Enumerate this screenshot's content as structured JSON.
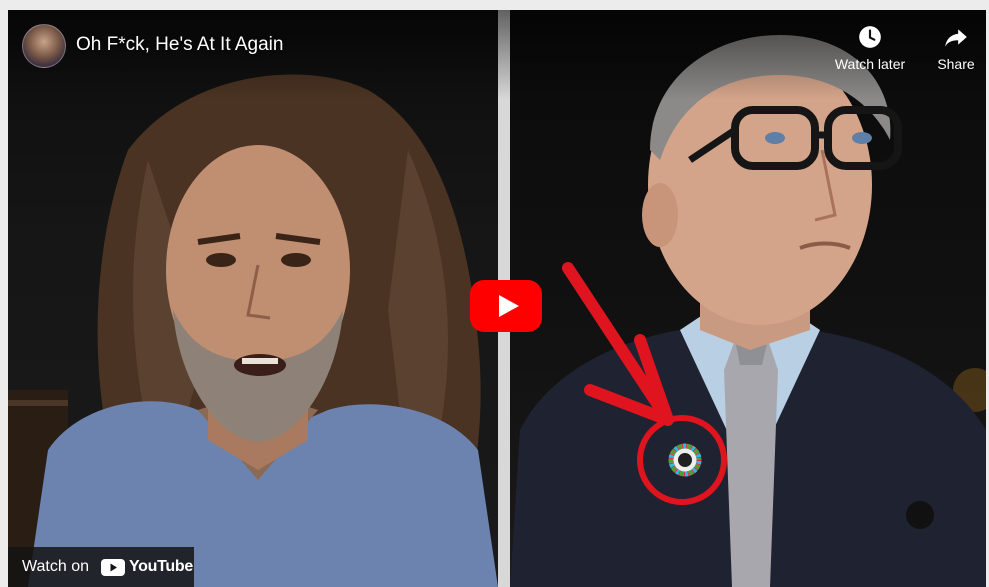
{
  "video": {
    "title": "Oh F*ck, He's At It Again",
    "channel_avatar": "channel-avatar"
  },
  "actions": {
    "watch_later_label": "Watch later",
    "share_label": "Share",
    "watch_later_icon": "clock-icon",
    "share_icon": "share-arrow-icon"
  },
  "player": {
    "play_icon": "youtube-play-icon",
    "accent_color": "#ff0000"
  },
  "footer": {
    "watch_on_label": "Watch on",
    "youtube_label": "YouTube"
  },
  "thumbnail": {
    "annotation_color": "#e0141e",
    "annotation_items": [
      "red-arrow",
      "red-circle-highlight"
    ],
    "pin": "sdg-color-wheel-pin"
  }
}
